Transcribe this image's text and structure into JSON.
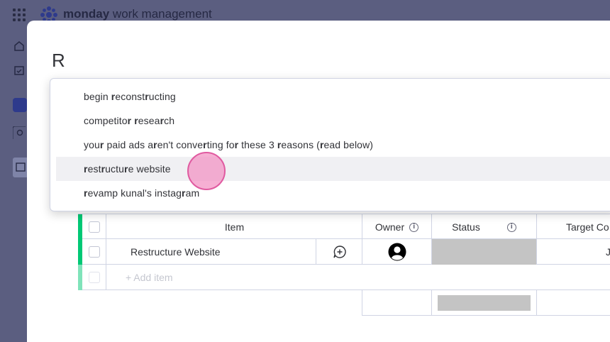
{
  "app": {
    "brand_bold": "monday",
    "brand_light": "work management"
  },
  "modal": {
    "title_value": "R"
  },
  "suggestions": [
    {
      "parts": [
        [
          "be"
        ],
        [
          "gin ",
          ""
        ],
        [
          "r",
          "b"
        ],
        [
          "econst",
          ""
        ],
        [
          "r",
          "b"
        ],
        [
          "ucting",
          ""
        ]
      ]
    },
    {
      "parts": []
    },
    {
      "parts": []
    },
    {
      "parts": []
    },
    {
      "parts": []
    }
  ],
  "suggestion_texts": [
    "begin reconstructing",
    "competitor research",
    "your paid ads aren't converting for these 3 reasons (read below)",
    "restructure website",
    "revamp kunal's instagram"
  ],
  "highlighted_index": 3,
  "table": {
    "columns": [
      "Item",
      "Owner",
      "Status",
      "Target Co"
    ],
    "rows": [
      {
        "item": "Restructure Website",
        "target": "J"
      }
    ],
    "add_item_placeholder": "+ Add item"
  },
  "colors": {
    "group_accent": "#00c875",
    "status_empty": "#c4c4c4",
    "highlight": "#f0f0f3"
  }
}
